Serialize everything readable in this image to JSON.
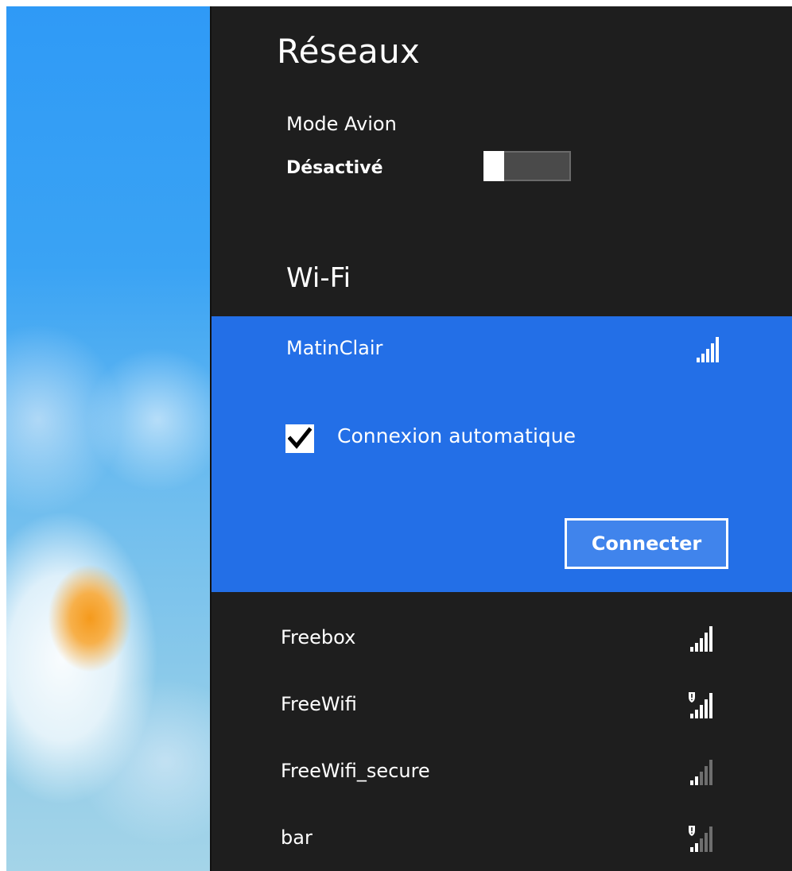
{
  "panel": {
    "title": "Réseaux",
    "airplane_mode": {
      "label": "Mode Avion",
      "state": "Désactivé",
      "on": false
    },
    "wifi_heading": "Wi-Fi"
  },
  "selected_network": {
    "name": "MatinClair",
    "signal_bars": 5,
    "auto_connect": {
      "label": "Connexion automatique",
      "checked": true
    },
    "connect_label": "Connecter"
  },
  "networks": [
    {
      "name": "Freebox",
      "signal_bars": 5,
      "secured_warning": false
    },
    {
      "name": "FreeWifi",
      "signal_bars": 5,
      "secured_warning": true
    },
    {
      "name": "FreeWifi_secure",
      "signal_bars": 2,
      "secured_warning": false
    },
    {
      "name": "bar",
      "signal_bars": 2,
      "secured_warning": true
    }
  ],
  "colors": {
    "panel_bg": "#1e1e1e",
    "selected_bg": "#236fe7",
    "button_bg": "#4084ec",
    "dim_bar": "#6e6e6e"
  },
  "icons": [
    "wifi-signal-icon",
    "shield-warning-icon",
    "checkmark-icon"
  ]
}
